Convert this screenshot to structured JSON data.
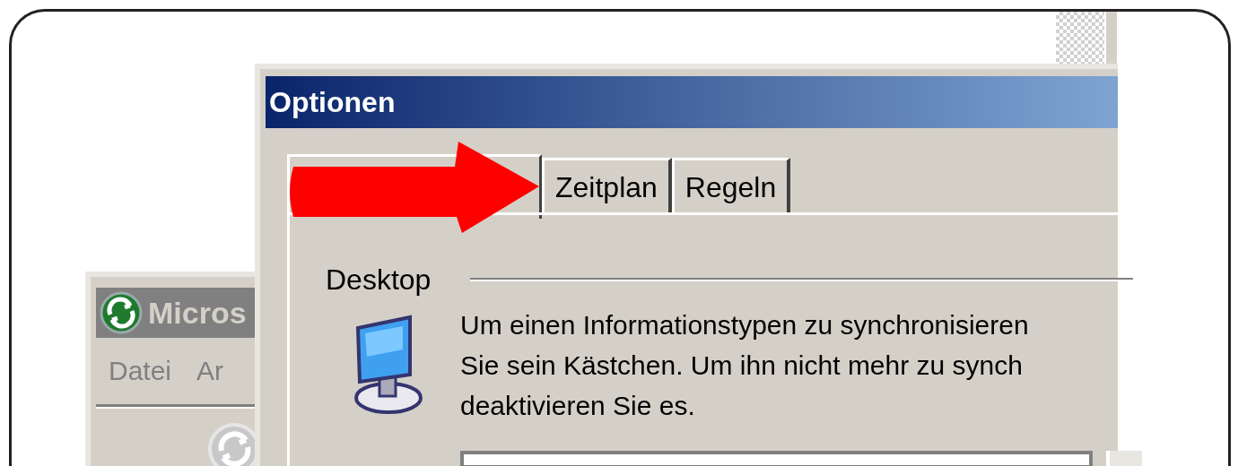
{
  "background_window": {
    "title": "Micros",
    "menu": [
      "Datei",
      "Ar"
    ]
  },
  "dialog": {
    "title": "Optionen",
    "tabs": [
      {
        "selected": true
      },
      {
        "label": "Zeitplan",
        "selected": false
      },
      {
        "label": "Regeln",
        "selected": false
      }
    ],
    "group": {
      "label": "Desktop",
      "description": "Um einen Informationstypen zu synchronisieren\nSie sein Kästchen. Um ihn nicht mehr zu synch\ndeaktivieren Sie es."
    }
  }
}
